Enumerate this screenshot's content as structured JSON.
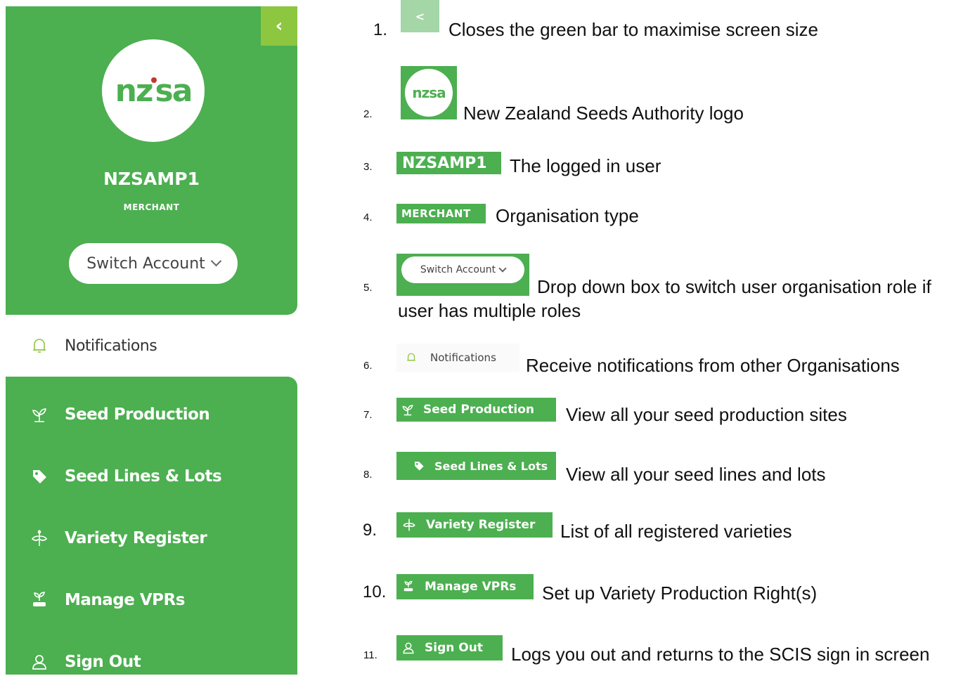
{
  "sidebar": {
    "collapse_label": "‹",
    "logo": "nzsa",
    "user_name": "NZSAMP1",
    "org_type": "MERCHANT",
    "switch_account": "Switch Account",
    "items": [
      {
        "label": "Notifications",
        "icon": "bell-icon"
      },
      {
        "label": "Seed Production",
        "icon": "seedling-icon"
      },
      {
        "label": "Seed Lines & Lots",
        "icon": "tag-icon"
      },
      {
        "label": "Variety Register",
        "icon": "plant-icon"
      },
      {
        "label": "Manage VPRs",
        "icon": "hand-plant-icon"
      },
      {
        "label": "Sign Out",
        "icon": "user-icon"
      }
    ]
  },
  "legend": [
    {
      "num": "1.",
      "chip": "<",
      "desc": "Closes the green bar to maximise screen size"
    },
    {
      "num": "2.",
      "chip": "nzsa",
      "desc": "New Zealand Seeds Authority logo"
    },
    {
      "num": "3.",
      "chip": "NZSAMP1",
      "desc": "The logged in user"
    },
    {
      "num": "4.",
      "chip": "MERCHANT",
      "desc": "Organisation type"
    },
    {
      "num": "5.",
      "chip": "Switch Account",
      "desc": "Drop down box to switch user organisation role if",
      "desc2": "user has multiple roles"
    },
    {
      "num": "6.",
      "chip": "Notifications",
      "desc": "Receive notifications from other Organisations"
    },
    {
      "num": "7.",
      "chip": "Seed Production",
      "desc": "View all your seed production sites"
    },
    {
      "num": "8.",
      "chip": "Seed Lines & Lots",
      "desc": "View all your seed lines and lots"
    },
    {
      "num": "9.",
      "chip": "Variety Register",
      "desc": "List of all registered varieties"
    },
    {
      "num": "10.",
      "chip": "Manage VPRs",
      "desc": "Set up Variety Production Right(s)"
    },
    {
      "num": "11.",
      "chip": "Sign Out",
      "desc": "Logs you out and returns to the SCIS sign in screen"
    }
  ],
  "colors": {
    "green": "#4caf50",
    "light_green": "#8dc63f",
    "logo_dot": "#c0392b"
  }
}
